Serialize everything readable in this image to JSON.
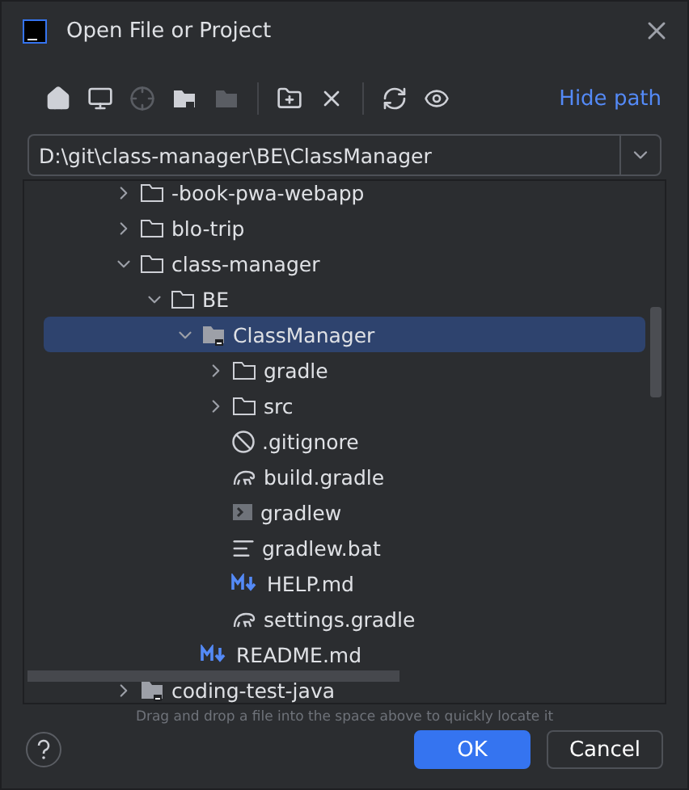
{
  "window": {
    "title": "Open File or Project"
  },
  "toolbar": [
    {
      "kind": "home",
      "disabled": false
    },
    {
      "kind": "desktop",
      "disabled": false
    },
    {
      "kind": "target",
      "disabled": true
    },
    {
      "kind": "module",
      "disabled": false
    },
    {
      "kind": "folder",
      "disabled": true
    },
    {
      "kind": "separator"
    },
    {
      "kind": "new-folder",
      "disabled": false
    },
    {
      "kind": "delete",
      "disabled": false
    },
    {
      "kind": "separator"
    },
    {
      "kind": "refresh",
      "disabled": false
    },
    {
      "kind": "hidden",
      "disabled": false
    }
  ],
  "hide_path": "Hide path",
  "path": {
    "value": "D:\\git\\class-manager\\BE\\ClassManager"
  },
  "tree": [
    {
      "label": "-book-pwa-webapp",
      "kind": "folder",
      "expanded": false,
      "selected": false
    },
    {
      "label": "blo-trip",
      "kind": "folder",
      "expanded": false,
      "selected": false
    },
    {
      "label": "class-manager",
      "kind": "folder",
      "expanded": true,
      "selected": false,
      "children": [
        {
          "label": "BE",
          "kind": "folder",
          "expanded": true,
          "selected": false,
          "children": [
            {
              "label": "ClassManager",
              "kind": "module",
              "expanded": true,
              "selected": true,
              "children": [
                {
                  "label": "gradle",
                  "kind": "folder",
                  "expanded": false,
                  "selected": false
                },
                {
                  "label": "src",
                  "kind": "folder",
                  "expanded": false,
                  "selected": false
                },
                {
                  "label": ".gitignore",
                  "kind": "ignore",
                  "selected": false
                },
                {
                  "label": "build.gradle",
                  "kind": "gradle",
                  "selected": false
                },
                {
                  "label": "gradlew",
                  "kind": "script",
                  "selected": false
                },
                {
                  "label": "gradlew.bat",
                  "kind": "text",
                  "selected": false
                },
                {
                  "label": "HELP.md",
                  "kind": "markdown",
                  "selected": false
                },
                {
                  "label": "settings.gradle",
                  "kind": "gradle",
                  "selected": false
                }
              ]
            },
            {
              "label": "README.md",
              "kind": "markdown",
              "selected": false
            }
          ]
        }
      ]
    },
    {
      "label": "coding-test-java",
      "kind": "module",
      "expanded": false,
      "selected": false
    }
  ],
  "hint": "Drag and drop a file into the space above to quickly locate it",
  "buttons": [
    {
      "label": "OK",
      "primary": true
    },
    {
      "label": "Cancel",
      "primary": false
    }
  ]
}
